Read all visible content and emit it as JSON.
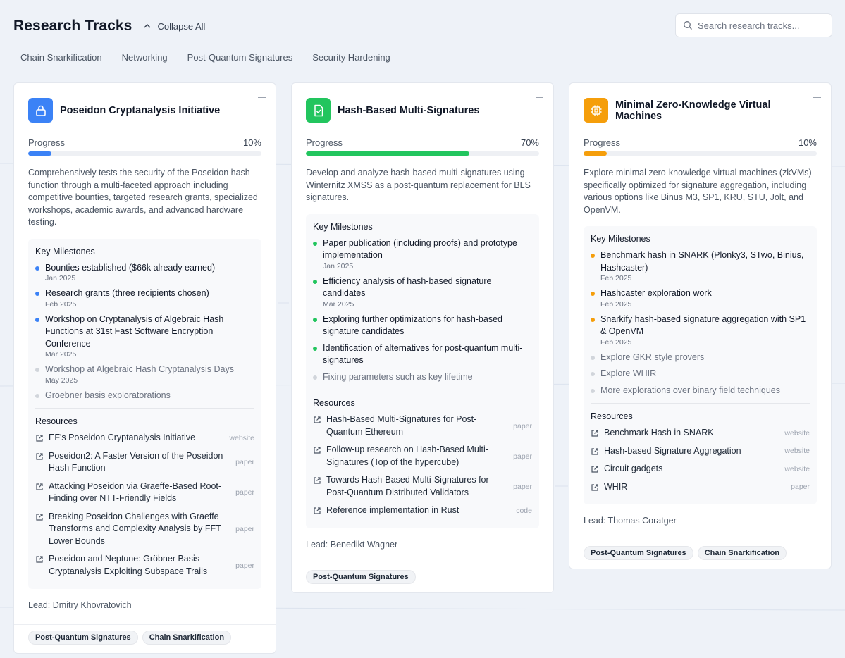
{
  "header": {
    "title": "Research Tracks",
    "collapse_label": "Collapse All",
    "search_placeholder": "Search research tracks..."
  },
  "filters": [
    "Chain Snarkification",
    "Networking",
    "Post-Quantum Signatures",
    "Security Hardening"
  ],
  "labels": {
    "progress": "Progress",
    "milestones": "Key Milestones",
    "resources": "Resources"
  },
  "colors": {
    "blue": "#3b82f6",
    "green": "#22c55e",
    "orange": "#f59e0b"
  },
  "cards": [
    {
      "title": "Poseidon Cryptanalysis Initiative",
      "icon": "lock-icon",
      "accent": "#3b82f6",
      "progress": 10,
      "progress_label": "10%",
      "description": "Comprehensively tests the security of the Poseidon hash function through a multi-faceted approach including competitive bounties, targeted research grants, specialized workshops, academic awards, and advanced hardware testing.",
      "milestones": [
        {
          "text": "Bounties established ($66k already earned)",
          "date": "Jan 2025",
          "done": true
        },
        {
          "text": "Research grants (three recipients chosen)",
          "date": "Feb 2025",
          "done": true
        },
        {
          "text": "Workshop on Cryptanalysis of Algebraic Hash Functions at 31st Fast Software Encryption Conference",
          "date": "Mar 2025",
          "done": true
        },
        {
          "text": "Workshop at Algebraic Hash Cryptanalysis Days",
          "date": "May 2025",
          "done": false
        },
        {
          "text": "Groebner basis exploratorations",
          "date": "",
          "done": false
        }
      ],
      "resources": [
        {
          "text": "EF's Poseidon Cryptanalysis Initiative",
          "type": "website"
        },
        {
          "text": "Poseidon2: A Faster Version of the Poseidon Hash Function",
          "type": "paper"
        },
        {
          "text": "Attacking Poseidon via Graeffe-Based Root-Finding over NTT-Friendly Fields",
          "type": "paper"
        },
        {
          "text": "Breaking Poseidon Challenges with Graeffe Transforms and Complexity Analysis by FFT Lower Bounds",
          "type": "paper"
        },
        {
          "text": "Poseidon and Neptune: Gröbner Basis Cryptanalysis Exploiting Subspace Trails",
          "type": "paper"
        }
      ],
      "lead": "Lead: Dmitry Khovratovich",
      "tags": [
        "Post-Quantum Signatures",
        "Chain Snarkification"
      ]
    },
    {
      "title": "Hash-Based Multi-Signatures",
      "icon": "file-check-icon",
      "accent": "#22c55e",
      "progress": 70,
      "progress_label": "70%",
      "description": "Develop and analyze hash-based multi-signatures using Winternitz XMSS as a post-quantum replacement for BLS signatures.",
      "milestones": [
        {
          "text": "Paper publication (including proofs) and prototype implementation",
          "date": "Jan 2025",
          "done": true
        },
        {
          "text": "Efficiency analysis of hash-based signature candidates",
          "date": "Mar 2025",
          "done": true
        },
        {
          "text": "Exploring further optimizations for hash-based signature candidates",
          "date": "",
          "done": true
        },
        {
          "text": "Identification of alternatives for post-quantum multi-signatures",
          "date": "",
          "done": true
        },
        {
          "text": "Fixing parameters such as key lifetime",
          "date": "",
          "done": false
        }
      ],
      "resources": [
        {
          "text": "Hash-Based Multi-Signatures for Post-Quantum Ethereum",
          "type": "paper"
        },
        {
          "text": "Follow-up research on Hash-Based Multi-Signatures (Top of the hypercube)",
          "type": "paper"
        },
        {
          "text": "Towards Hash-Based Multi-Signatures for Post-Quantum Distributed Validators",
          "type": "paper"
        },
        {
          "text": "Reference implementation in Rust",
          "type": "code"
        }
      ],
      "lead": "Lead: Benedikt Wagner",
      "tags": [
        "Post-Quantum Signatures"
      ]
    },
    {
      "title": "Minimal Zero-Knowledge Virtual Machines",
      "icon": "cpu-icon",
      "accent": "#f59e0b",
      "progress": 10,
      "progress_label": "10%",
      "description": "Explore minimal zero-knowledge virtual machines (zkVMs) specifically optimized for signature aggregation, including various options like Binus M3, SP1, KRU, STU, Jolt, and OpenVM.",
      "milestones": [
        {
          "text": "Benchmark hash in SNARK (Plonky3, STwo, Binius, Hashcaster)",
          "date": "Feb 2025",
          "done": true
        },
        {
          "text": "Hashcaster exploration work",
          "date": "Feb 2025",
          "done": true
        },
        {
          "text": "Snarkify hash-based signature aggregation with SP1 & OpenVM",
          "date": "Feb 2025",
          "done": true
        },
        {
          "text": "Explore GKR style provers",
          "date": "",
          "done": false
        },
        {
          "text": "Explore WHIR",
          "date": "",
          "done": false
        },
        {
          "text": "More explorations over binary field techniques",
          "date": "",
          "done": false
        }
      ],
      "resources": [
        {
          "text": "Benchmark Hash in SNARK",
          "type": "website"
        },
        {
          "text": "Hash-based Signature Aggregation",
          "type": "website"
        },
        {
          "text": "Circuit gadgets",
          "type": "website"
        },
        {
          "text": "WHIR",
          "type": "paper"
        }
      ],
      "lead": "Lead: Thomas Coratger",
      "tags": [
        "Post-Quantum Signatures",
        "Chain Snarkification"
      ]
    }
  ]
}
